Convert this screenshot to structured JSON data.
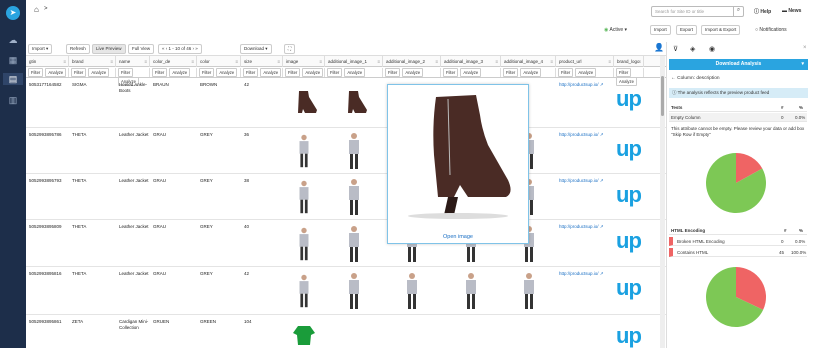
{
  "nav": {
    "home_icon": "home-icon",
    "breadcrumb_sep": ">",
    "icons": [
      "cloud-icon",
      "map-icon",
      "grid-icon",
      "chart-icon"
    ]
  },
  "header": {
    "search_placeholder": "Search for Site ID or title",
    "help": "Help",
    "news": "News",
    "status": "Active",
    "actions": [
      "Import",
      "Export",
      "Import & Export"
    ],
    "notifications": "Notifications"
  },
  "toolbar": {
    "import": "Import",
    "refresh": "Refresh",
    "live_preview": "Live Preview",
    "full_view": "Full View",
    "pager": "1 - 10 of 46",
    "download": "Download"
  },
  "columns": [
    "gtin",
    "brand",
    "name",
    "color_de",
    "color",
    "size",
    "image",
    "additional_image_1",
    "additional_image_2",
    "additional_image_3",
    "additional_image_4",
    "product_url",
    "brand_logo"
  ],
  "filter": {
    "filter": "Filter",
    "analyze": "Analyze"
  },
  "rows": [
    {
      "gtin": "5053177164582",
      "brand": "SIGMA",
      "name": "Heeled Ankle-Boots",
      "color_de": "BRAUN",
      "color": "BROWN",
      "size": "42",
      "url": "http://productsup.io/"
    },
    {
      "gtin": "5052993895786",
      "brand": "THETA",
      "name": "Leather Jacket",
      "color_de": "GRAU",
      "color": "GREY",
      "size": "36",
      "url": "http://productsup.io/"
    },
    {
      "gtin": "5052993895793",
      "brand": "THETA",
      "name": "Leather Jacket",
      "color_de": "GRAU",
      "color": "GREY",
      "size": "38",
      "url": "http://productsup.io/"
    },
    {
      "gtin": "5052993895809",
      "brand": "THETA",
      "name": "Leather Jacket",
      "color_de": "GRAU",
      "color": "GREY",
      "size": "40",
      "url": "http://productsup.io/"
    },
    {
      "gtin": "5052993895816",
      "brand": "THETA",
      "name": "Leather Jacket",
      "color_de": "GRAU",
      "color": "GREY",
      "size": "42",
      "url": "http://productsup.io/"
    },
    {
      "gtin": "5052993895861",
      "brand": "ZETA",
      "name": "Cardigan Mini-Collection",
      "color_de": "GRUEN",
      "color": "GREEN",
      "size": "104",
      "url": ""
    }
  ],
  "brand_logo_text": "up",
  "preview": {
    "open": "Open image"
  },
  "panel": {
    "title": "Download Analysis",
    "column_label": "Column: description",
    "info": "The analysis reflects the preview product feed",
    "t1_head": [
      "Tests",
      "#",
      "%"
    ],
    "t1_rows": [
      [
        "Empty Column",
        "0",
        "0.0%"
      ]
    ],
    "warning": "This attribute cannot be empty. Please review your data or add box \"Skip Row if Empty\"",
    "t2_head": [
      "HTML Encoding",
      "#",
      "%"
    ],
    "t2_rows": [
      [
        "Broken HTML Encoding",
        "0",
        "0.0%"
      ],
      [
        "Contains HTML",
        "45",
        "100.0%"
      ]
    ],
    "pie1": {
      "green": 83,
      "red": 17
    },
    "pie2": {
      "green": 68,
      "red": 32
    },
    "colors": {
      "green": "#7dc855",
      "red": "#ef6464",
      "accent": "#2aa4e0"
    }
  }
}
